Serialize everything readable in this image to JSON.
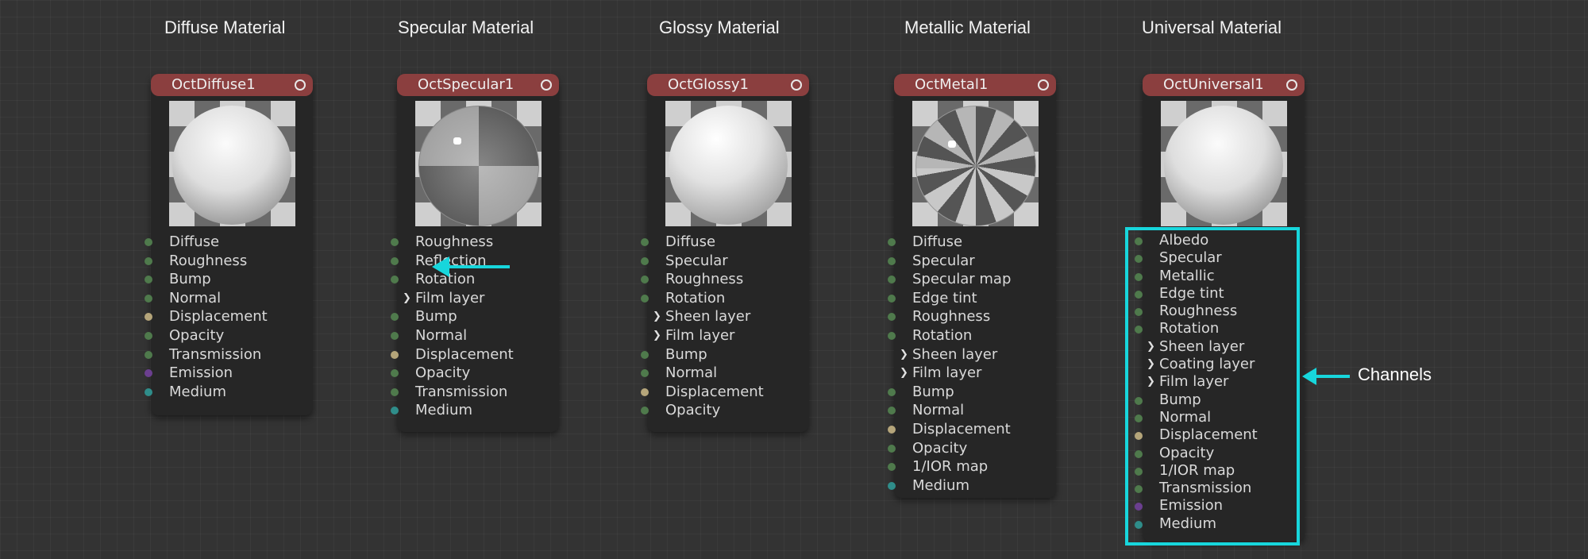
{
  "accent_color": "#17d6dc",
  "nodes": [
    {
      "title": "Diffuse Material",
      "header": "OctDiffuse1",
      "preview": "diffuse",
      "rows": [
        {
          "label": "Diffuse",
          "dot": "green"
        },
        {
          "label": "Roughness",
          "dot": "green"
        },
        {
          "label": "Bump",
          "dot": "green"
        },
        {
          "label": "Normal",
          "dot": "green"
        },
        {
          "label": "Displacement",
          "dot": "tan"
        },
        {
          "label": "Opacity",
          "dot": "green"
        },
        {
          "label": "Transmission",
          "dot": "green"
        },
        {
          "label": "Emission",
          "dot": "purple"
        },
        {
          "label": "Medium",
          "dot": "teal"
        }
      ]
    },
    {
      "title": "Specular Material",
      "header": "OctSpecular1",
      "preview": "specular",
      "rows": [
        {
          "label": "Roughness",
          "dot": "green"
        },
        {
          "label": "Reflection",
          "dot": "green"
        },
        {
          "label": "Rotation",
          "dot": "green"
        },
        {
          "label": "Film layer",
          "chevron": true
        },
        {
          "label": "Bump",
          "dot": "green"
        },
        {
          "label": "Normal",
          "dot": "green"
        },
        {
          "label": "Displacement",
          "dot": "tan"
        },
        {
          "label": "Opacity",
          "dot": "green"
        },
        {
          "label": "Transmission",
          "dot": "green"
        },
        {
          "label": "Medium",
          "dot": "teal"
        }
      ]
    },
    {
      "title": "Glossy Material",
      "header": "OctGlossy1",
      "preview": "glossy",
      "rows": [
        {
          "label": "Diffuse",
          "dot": "green"
        },
        {
          "label": "Specular",
          "dot": "green"
        },
        {
          "label": "Roughness",
          "dot": "green"
        },
        {
          "label": "Rotation",
          "dot": "green"
        },
        {
          "label": "Sheen layer",
          "chevron": true
        },
        {
          "label": "Film layer",
          "chevron": true
        },
        {
          "label": "Bump",
          "dot": "green"
        },
        {
          "label": "Normal",
          "dot": "green"
        },
        {
          "label": "Displacement",
          "dot": "tan"
        },
        {
          "label": "Opacity",
          "dot": "green"
        }
      ]
    },
    {
      "title": "Metallic Material",
      "header": "OctMetal1",
      "preview": "metal",
      "rows": [
        {
          "label": "Diffuse",
          "dot": "green"
        },
        {
          "label": "Specular",
          "dot": "green"
        },
        {
          "label": "Specular map",
          "dot": "green"
        },
        {
          "label": "Edge tint",
          "dot": "green"
        },
        {
          "label": "Roughness",
          "dot": "green"
        },
        {
          "label": "Rotation",
          "dot": "green"
        },
        {
          "label": "Sheen layer",
          "chevron": true
        },
        {
          "label": "Film layer",
          "chevron": true
        },
        {
          "label": "Bump",
          "dot": "green"
        },
        {
          "label": "Normal",
          "dot": "green"
        },
        {
          "label": "Displacement",
          "dot": "tan"
        },
        {
          "label": "Opacity",
          "dot": "green"
        },
        {
          "label": "1/IOR map",
          "dot": "green"
        },
        {
          "label": "Medium",
          "dot": "teal"
        }
      ]
    },
    {
      "title": "Universal Material",
      "header": "OctUniversal1",
      "preview": "diffuse",
      "rows": [
        {
          "label": "Albedo",
          "dot": "green"
        },
        {
          "label": "Specular",
          "dot": "green"
        },
        {
          "label": "Metallic",
          "dot": "green"
        },
        {
          "label": "Edge tint",
          "dot": "green"
        },
        {
          "label": "Roughness",
          "dot": "green"
        },
        {
          "label": "Rotation",
          "dot": "green"
        },
        {
          "label": "Sheen layer",
          "chevron": true
        },
        {
          "label": "Coating layer",
          "chevron": true
        },
        {
          "label": "Film layer",
          "chevron": true
        },
        {
          "label": "Bump",
          "dot": "green"
        },
        {
          "label": "Normal",
          "dot": "green"
        },
        {
          "label": "Displacement",
          "dot": "tan"
        },
        {
          "label": "Opacity",
          "dot": "green"
        },
        {
          "label": "1/IOR map",
          "dot": "green"
        },
        {
          "label": "Transmission",
          "dot": "green"
        },
        {
          "label": "Emission",
          "dot": "purple"
        },
        {
          "label": "Medium",
          "dot": "teal"
        }
      ]
    }
  ],
  "annotation": {
    "channels_label": "Channels"
  }
}
